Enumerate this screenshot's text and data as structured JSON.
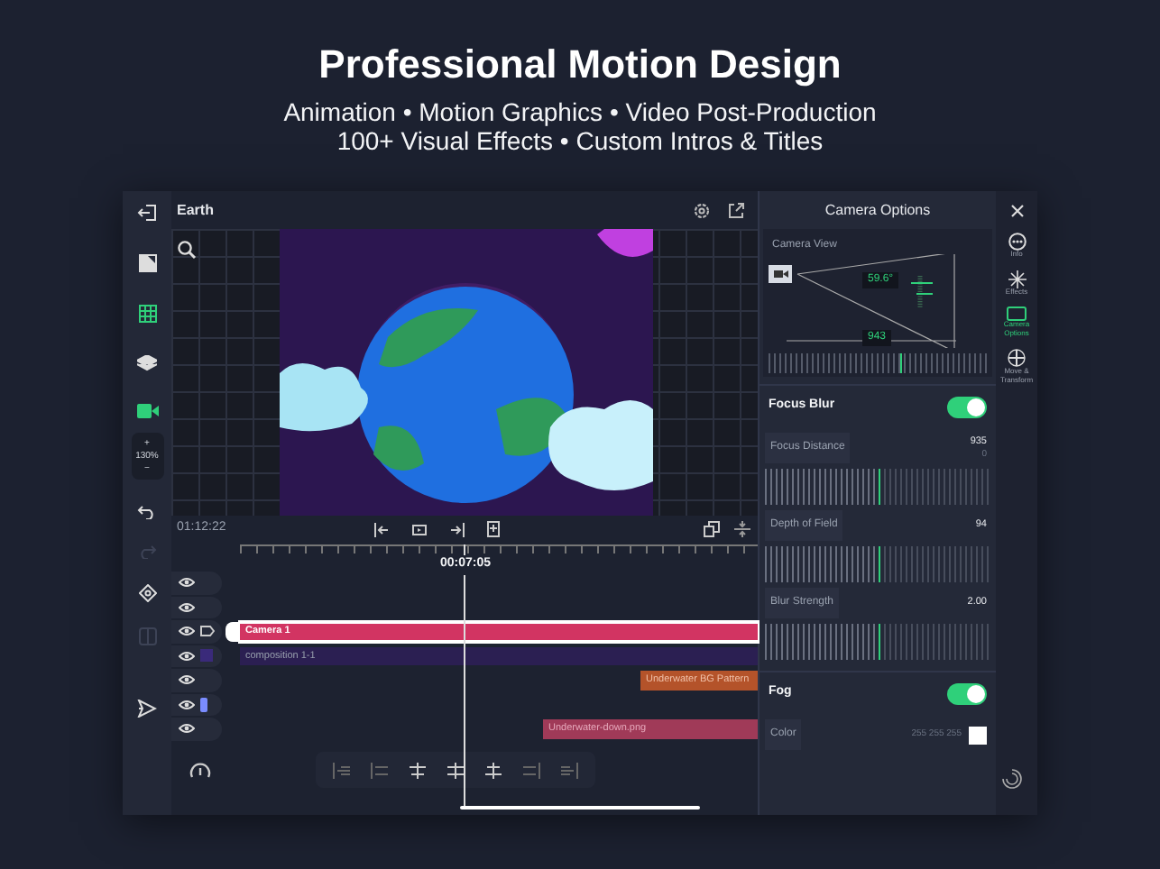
{
  "headline": "Professional Motion Design",
  "subtitle": [
    "Animation • Motion Graphics • Video Post-Production",
    "100+ Visual Effects • Custom Intros & Titles"
  ],
  "toolbar": {
    "tools": [
      {
        "kind": "exit",
        "selected": false
      },
      {
        "kind": "aspect",
        "selected": false
      },
      {
        "kind": "grid",
        "selected": true
      },
      {
        "kind": "layers",
        "selected": false
      },
      {
        "kind": "camera",
        "selected": true
      }
    ],
    "zoom": {
      "plus": "+",
      "value": "130%",
      "minus": "−"
    },
    "actions": [
      {
        "kind": "undo",
        "disabled": false
      },
      {
        "kind": "redo",
        "disabled": true
      },
      {
        "kind": "keyframe",
        "disabled": false
      },
      {
        "kind": "split",
        "disabled": true
      },
      {
        "kind": "export",
        "disabled": false
      }
    ]
  },
  "canvas": {
    "title": "Earth"
  },
  "timeline": {
    "duration": "01:12:22",
    "playhead": "00:07:05",
    "tracks": [
      {
        "kind": "plain"
      },
      {
        "kind": "plain"
      },
      {
        "kind": "camera",
        "clip": {
          "label": "Camera 1",
          "kind": "camera",
          "selected": true
        }
      },
      {
        "kind": "composition",
        "clip": {
          "label": "composition 1-1",
          "kind": "composition",
          "selected": false
        }
      },
      {
        "kind": "plain",
        "clip": {
          "label": "Underwater BG Pattern",
          "kind": "pattern",
          "selected": false
        }
      },
      {
        "kind": "image"
      },
      {
        "kind": "plain",
        "clip": {
          "label": "Underwater-down.png",
          "kind": "image",
          "selected": false
        }
      }
    ]
  },
  "panel": {
    "title": "Camera Options",
    "camera_view": {
      "label": "Camera View",
      "angle": "59.6°",
      "distance": "943",
      "level": 0.6
    },
    "sections": [
      {
        "title": "Focus Blur",
        "on": true,
        "rows": [
          {
            "kind": "slider",
            "label": "Focus Distance",
            "value": "935",
            "sub": "0",
            "level": 0.5
          },
          {
            "kind": "slider",
            "label": "Depth of Field",
            "value": "94",
            "level": 0.5
          },
          {
            "kind": "slider",
            "label": "Blur Strength",
            "value": "2.00",
            "level": 0.5
          }
        ]
      },
      {
        "title": "Fog",
        "on": true,
        "rows": [
          {
            "kind": "color",
            "label": "Color",
            "value": "255 255 255",
            "color": "#ffffff"
          }
        ]
      }
    ]
  },
  "rail": [
    {
      "kind": "info",
      "label": "Info",
      "selected": false
    },
    {
      "kind": "effects",
      "label": "Effects",
      "selected": false
    },
    {
      "kind": "camera",
      "label": "Camera Options",
      "selected": true
    },
    {
      "kind": "move",
      "label": "Move & Transform",
      "selected": false
    }
  ]
}
